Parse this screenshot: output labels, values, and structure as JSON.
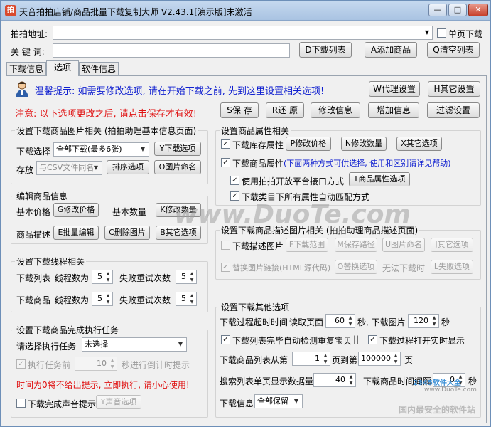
{
  "window": {
    "title": "天音拍拍店铺/商品批量下载复制大师 V2.43.1[演示版]未激活",
    "icon_name": "app-icon",
    "controls": [
      "minimize-icon",
      "restore-icon",
      "close-icon"
    ]
  },
  "top": {
    "url_label": "拍拍地址:",
    "url_value": "",
    "single_page_label": "单页下载",
    "keyword_label": "关 键 词:",
    "keyword_value": "",
    "download_list_btn": "D下载列表",
    "add_product_btn": "A添加商品",
    "clear_list_btn": "Q清空列表"
  },
  "tabs": [
    {
      "label": "下载信息",
      "active": false
    },
    {
      "label": "选项",
      "active": true
    },
    {
      "label": "软件信息",
      "active": false
    }
  ],
  "tip": {
    "icon_name": "user-tip-icon",
    "text": "温馨提示: 如需要修改选项, 请在开始下载之前, 先到这里设置相关选项!",
    "proxy_btn": "W代理设置",
    "other_settings_btn": "H其它设置"
  },
  "notice": {
    "text": "注意: 以下选项更改之后, 请点击保存才有效!",
    "save_btn": "S保 存",
    "restore_btn": "R还 原",
    "modify_btn": "修改信息",
    "add_btn": "增加信息",
    "filter_btn": "过滤设置"
  },
  "image_group": {
    "title": "设置下载商品图片相关 (拍拍助理基本信息页面)",
    "select_label": "下载选择",
    "select_value": "全部下载(最多6张)",
    "download_opts_btn": "Y下载选项",
    "store_label": "存放",
    "store_value": "与CSV文件同名",
    "sort_btn": "排序选项",
    "rename_btn": "O图片命名"
  },
  "edit_group": {
    "title": "编辑商品信息",
    "base_price_label": "基本价格",
    "modify_price_btn": "G修改价格",
    "base_qty_label": "基本数量",
    "modify_qty_btn": "K修改数量",
    "desc_label": "商品描述",
    "batch_edit_btn": "E批量编辑",
    "delete_img_btn": "C删除图片",
    "other_opts_btn": "B其它选项"
  },
  "thread_group": {
    "title": "设置下载线程相关",
    "list_label": "下载列表",
    "list_threads_label": "线程数为",
    "list_threads": "5",
    "list_retry_label": "失败重试次数",
    "list_retry": "5",
    "product_label": "下载商品",
    "product_threads_label": "线程数为",
    "product_threads": "5",
    "product_retry_label": "失败重试次数",
    "product_retry": "5"
  },
  "task_group": {
    "title": "设置下载商品完成执行任务",
    "select_label": "请选择执行任务",
    "select_value": "未选择",
    "exec_before_label": "执行任务前",
    "countdown_value": "10",
    "countdown_label": "秒进行倒计时提示",
    "warning": "时间为0将不给出提示, 立即执行, 请小心使用!",
    "sound_label": "下载完成声音提示",
    "sound_btn": "Y声音选项"
  },
  "attr_group": {
    "title": "设置商品属性相关",
    "stock_label": "下载库存属性",
    "modify_price_btn": "P修改价格",
    "modify_qty_btn": "N修改数量",
    "other_opts_btn": "X其它选项",
    "attr_label": "下载商品属性",
    "attr_link": "(下面两种方式可供选择, 使用和区别请详见帮助)",
    "use_api_label": "使用拍拍开放平台接口方式",
    "attr_opts_btn": "T商品属性选项",
    "auto_match_label": "下载类目下所有属性自动匹配方式"
  },
  "desc_group": {
    "title": "设置下载商品描述图片相关 (拍拍助理商品描述页面)",
    "desc_img_label": "下载描述图片",
    "range_btn": "F下载范围",
    "save_path_btn": "M保存路径",
    "img_name_btn": "U图片命名",
    "other_opts_btn": "J其它选项",
    "replace_label": "替换图片链接(HTML源代码)",
    "replace_opts_btn": "O替换选项",
    "no_dl_label": "无法下载时",
    "fail_opts_btn": "L失败选项"
  },
  "other_group": {
    "title": "设置下载其他选项",
    "timeout_label": "下载过程超时时间",
    "read_page_label": "读取页面",
    "read_page_value": "60",
    "sec_label_1": "秒, 下载图片",
    "img_timeout_value": "120",
    "sec_label_2": "秒",
    "auto_detect_label": "下载列表",
    "auto_detect_text": "完毕自动检测重复宝贝",
    "separator": "||",
    "realtime_label": "下载过程打开实时显示",
    "list_from_label": "下载商品列表从第",
    "list_from_value": "1",
    "list_to_label": "页到第",
    "list_to_value": "100000",
    "page_label": "页",
    "search_qty_label": "搜索列表单页显示数据量",
    "search_qty_value": "40",
    "interval_label": "下载商品时间间隔",
    "interval_value": "0",
    "interval_unit": "秒",
    "info_label": "下载信息",
    "info_value": "全部保留"
  },
  "watermark": {
    "main": "www.DuoTe.com",
    "logo": "2345软件大全",
    "url": "www.DuoTe.com",
    "slogan": "国内最安全的软件站"
  }
}
